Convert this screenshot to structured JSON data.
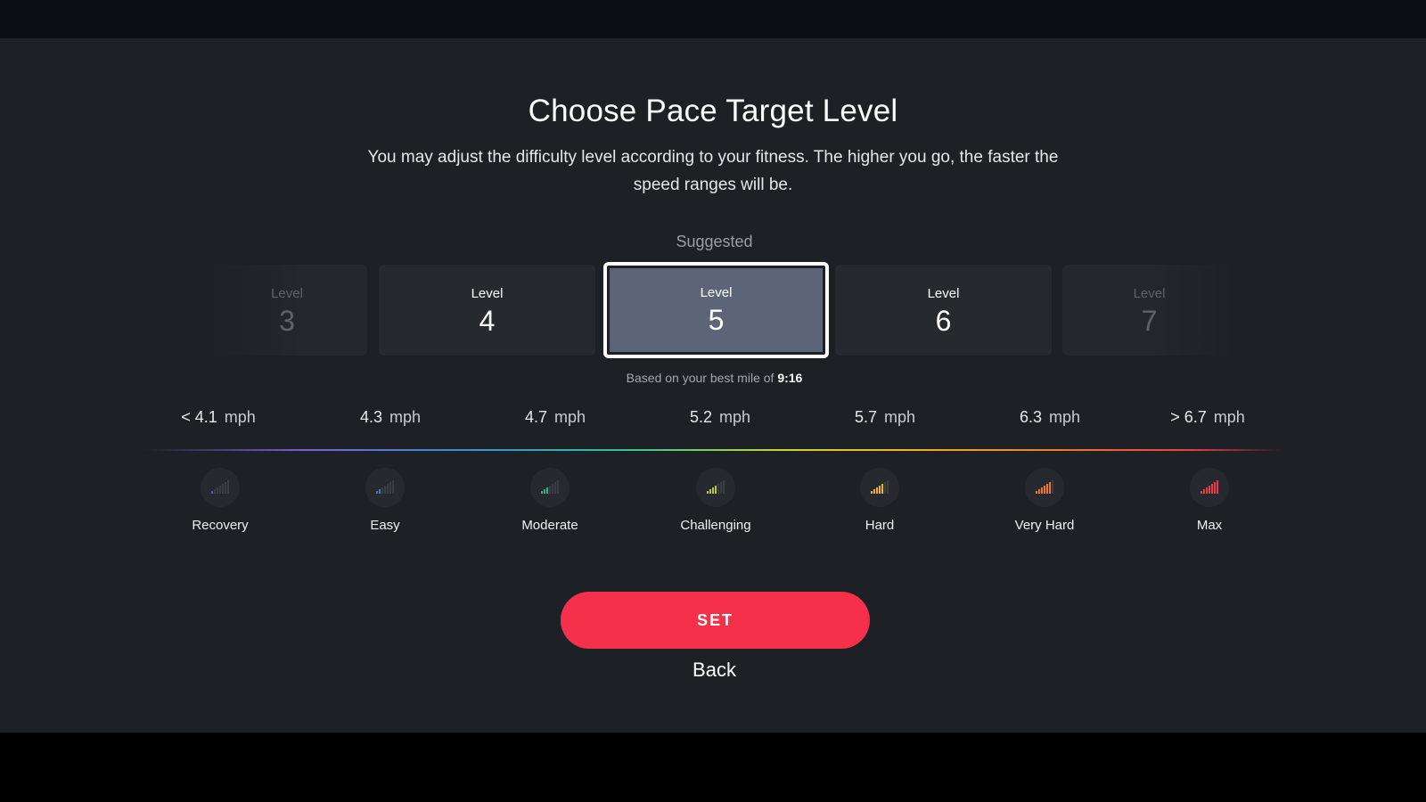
{
  "header": {
    "title": "Choose Pace Target Level",
    "subtitle": "You may adjust the difficulty level according to your fitness. The higher you go, the faster the speed ranges will be."
  },
  "suggested_label": "Suggested",
  "levels": [
    {
      "label": "Level",
      "number": "3",
      "state": "faded"
    },
    {
      "label": "Level",
      "number": "4",
      "state": "normal"
    },
    {
      "label": "Level",
      "number": "5",
      "state": "selected"
    },
    {
      "label": "Level",
      "number": "6",
      "state": "normal"
    },
    {
      "label": "Level",
      "number": "7",
      "state": "faded"
    }
  ],
  "based_on": {
    "prefix": "Based on your best mile of ",
    "value": "9:16"
  },
  "speeds": [
    {
      "value": "< 4.1",
      "unit": "mph"
    },
    {
      "value": "4.3",
      "unit": "mph"
    },
    {
      "value": "4.7",
      "unit": "mph"
    },
    {
      "value": "5.2",
      "unit": "mph"
    },
    {
      "value": "5.7",
      "unit": "mph"
    },
    {
      "value": "6.3",
      "unit": "mph"
    },
    {
      "value": "> 6.7",
      "unit": "mph"
    }
  ],
  "zones": [
    {
      "label": "Recovery",
      "icon": "signal-bars-icon",
      "color": "#5b55a8",
      "bars_lit": 1
    },
    {
      "label": "Easy",
      "icon": "signal-bars-icon",
      "color": "#3b7fc4",
      "bars_lit": 2
    },
    {
      "label": "Moderate",
      "icon": "signal-bars-icon",
      "color": "#2eb487",
      "bars_lit": 3
    },
    {
      "label": "Challenging",
      "icon": "signal-bars-icon",
      "color": "#b9c935",
      "bars_lit": 4
    },
    {
      "label": "Hard",
      "icon": "signal-bars-icon",
      "color": "#f0b429",
      "bars_lit": 5
    },
    {
      "label": "Very Hard",
      "icon": "signal-bars-icon",
      "color": "#f0792a",
      "bars_lit": 6
    },
    {
      "label": "Max",
      "icon": "signal-bars-icon",
      "color": "#ec3a4a",
      "bars_lit": 7
    }
  ],
  "actions": {
    "set_label": "SET",
    "back_label": "Back"
  },
  "colors": {
    "accent": "#f5304a",
    "selected_card": "#5c6577",
    "background": "#1d2024"
  }
}
